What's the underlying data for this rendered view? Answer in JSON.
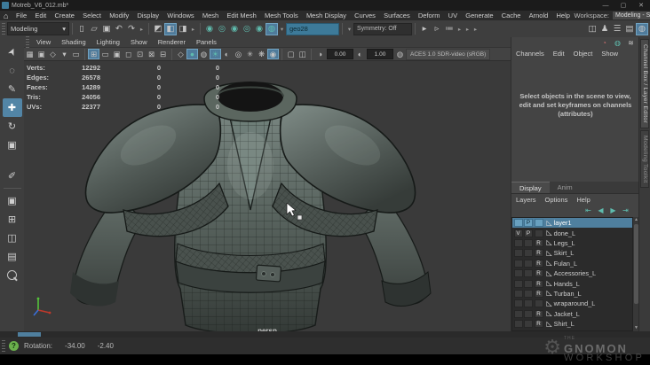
{
  "window": {
    "title": "Motreb_V6_012.mb*",
    "controls": {
      "minimize": "—",
      "maximize": "▢",
      "close": "✕"
    }
  },
  "menubar": {
    "items": [
      "File",
      "Edit",
      "Create",
      "Select",
      "Modify",
      "Display",
      "Windows",
      "Mesh",
      "Edit Mesh",
      "Mesh Tools",
      "Mesh Display",
      "Curves",
      "Surfaces",
      "Deform",
      "UV",
      "Generate",
      "Cache",
      "Arnold",
      "Help"
    ],
    "workspace_label": "Workspace:",
    "workspace_value": "Modeling - Standard*"
  },
  "shelf": {
    "mode": "Modeling",
    "selection_input": "geo28",
    "symmetry": "Symmetry: Off"
  },
  "viewport": {
    "menus": [
      "View",
      "Shading",
      "Lighting",
      "Show",
      "Renderer",
      "Panels"
    ],
    "exposure": "0.00",
    "gamma": "1.00",
    "colorspace": "ACES 1.0 SDR-video (sRGB)",
    "camera_label": "persp",
    "hud_rows": [
      {
        "label": "Verts:",
        "c1": "12292",
        "c2": "0",
        "c3": "0"
      },
      {
        "label": "Edges:",
        "c1": "26578",
        "c2": "0",
        "c3": "0"
      },
      {
        "label": "Faces:",
        "c1": "14289",
        "c2": "0",
        "c3": "0"
      },
      {
        "label": "Tris:",
        "c1": "24056",
        "c2": "0",
        "c3": "0"
      },
      {
        "label": "UVs:",
        "c1": "22377",
        "c2": "0",
        "c3": "0"
      }
    ]
  },
  "channel_box": {
    "menus": [
      "Channels",
      "Edit",
      "Object",
      "Show"
    ],
    "empty_message": "Select objects in the scene to view, edit and set keyframes on channels (attributes)"
  },
  "layer_editor": {
    "tabs": [
      "Display",
      "Anim"
    ],
    "menus": [
      "Layers",
      "Options",
      "Help"
    ],
    "layers": [
      {
        "v": "",
        "p": "P",
        "r": "",
        "name": "layer1",
        "selected": true
      },
      {
        "v": "V",
        "p": "P",
        "r": "",
        "name": "done_L",
        "selected": false
      },
      {
        "v": "",
        "p": "",
        "r": "R",
        "name": "Legs_L",
        "selected": false
      },
      {
        "v": "",
        "p": "",
        "r": "R",
        "name": "Skirt_L",
        "selected": false
      },
      {
        "v": "",
        "p": "",
        "r": "R",
        "name": "Fulan_L",
        "selected": false
      },
      {
        "v": "",
        "p": "",
        "r": "R",
        "name": "Accessories_L",
        "selected": false
      },
      {
        "v": "",
        "p": "",
        "r": "R",
        "name": "Hands_L",
        "selected": false
      },
      {
        "v": "",
        "p": "",
        "r": "R",
        "name": "Turban_L",
        "selected": false
      },
      {
        "v": "",
        "p": "",
        "r": "",
        "name": "wraparound_L",
        "selected": false
      },
      {
        "v": "",
        "p": "",
        "r": "R",
        "name": "Jacket_L",
        "selected": false
      },
      {
        "v": "",
        "p": "",
        "r": "R",
        "name": "Shirt_L",
        "selected": false
      }
    ]
  },
  "side_tabs": {
    "channel_box": "Channel Box / Layer Editor",
    "modeling_toolkit": "Modeling Toolkit"
  },
  "status_bar": {
    "help": "?",
    "rotation_label": "Rotation:",
    "rotation_x": "-34.00",
    "rotation_y": "-2.40"
  },
  "watermark": {
    "the": "THE",
    "line1": "GNOMON",
    "line2": "WORKSHOP"
  },
  "colors": {
    "selection_blue": "#4f7f9e",
    "input_highlight": "#3d7a99",
    "active_icon_blue": "#4f7b9b",
    "teal_icon": "#5fbcae",
    "help_green": "#6ab04c",
    "viewport_bg": "#3a3a3a"
  },
  "icons": {
    "home": "⌂",
    "dropdown": "▾",
    "flyout": "▸",
    "new_scene": "▯",
    "open_scene": "▱",
    "save_scene": "▣",
    "undo": "↶",
    "redo": "↷",
    "select_hierarchy": "◩",
    "select_object": "◧",
    "select_component": "◨",
    "snap_grid": "◉",
    "snap_curve": "◎",
    "snap_point": "◉",
    "snap_center": "◎",
    "snap_axis": "◉",
    "make_live": "◍",
    "render_open": "▸",
    "ipr_render": "▹",
    "render_settings": "≔",
    "attr_editor": "◫",
    "tool_settings": "♟",
    "channel_sliders": "☰",
    "display_layers": "▤",
    "modeling_toolkit": "◍",
    "select_tool": "➤",
    "lasso_tool": "◌",
    "paint_select_tool": "✎",
    "move_tool": "✚",
    "rotate_tool": "↻",
    "scale_tool": "▣",
    "last_tool": "✐",
    "layout_single": "▣",
    "layout_four": "⊞",
    "layout_two": "◫",
    "layout_outliner": "▤",
    "vp_select_camera": "▦",
    "vp_lock_camera": "▣",
    "vp_camera_attrs": "◇",
    "vp_bookmark": "▾",
    "vp_image_plane": "▭",
    "vp_grid": "⊞",
    "vp_film_gate": "▭",
    "vp_res_gate": "▣",
    "vp_gate_mask": "◻",
    "vp_field_chart": "⊡",
    "vp_safe_action": "⊠",
    "vp_safe_title": "⊟",
    "vp_wireframe": "◇",
    "vp_shaded": "●",
    "vp_textured": "◍",
    "vp_lights": "☀",
    "vp_shadows": "◐",
    "vp_ao": "◎",
    "vp_motion_blur": "✳",
    "vp_aa": "❋",
    "vp_dof": "◉",
    "vp_isolate": "▢",
    "vp_xray": "◫",
    "vp_exposure": "◑",
    "vp_gamma": "◐",
    "vp_view_transform": "◍",
    "cb_show_icons_1": "◔",
    "cb_show_icons_2": "◍",
    "cb_show_icons_3": "≋",
    "layer_btn_1": "⇤",
    "layer_btn_2": "◀",
    "layer_btn_3": "▶",
    "layer_btn_4": "⇥",
    "layer_item": "◺",
    "scroll_up": "▲",
    "scroll_down": "▼",
    "scroll_left": "◀",
    "scroll_right": "▶"
  }
}
